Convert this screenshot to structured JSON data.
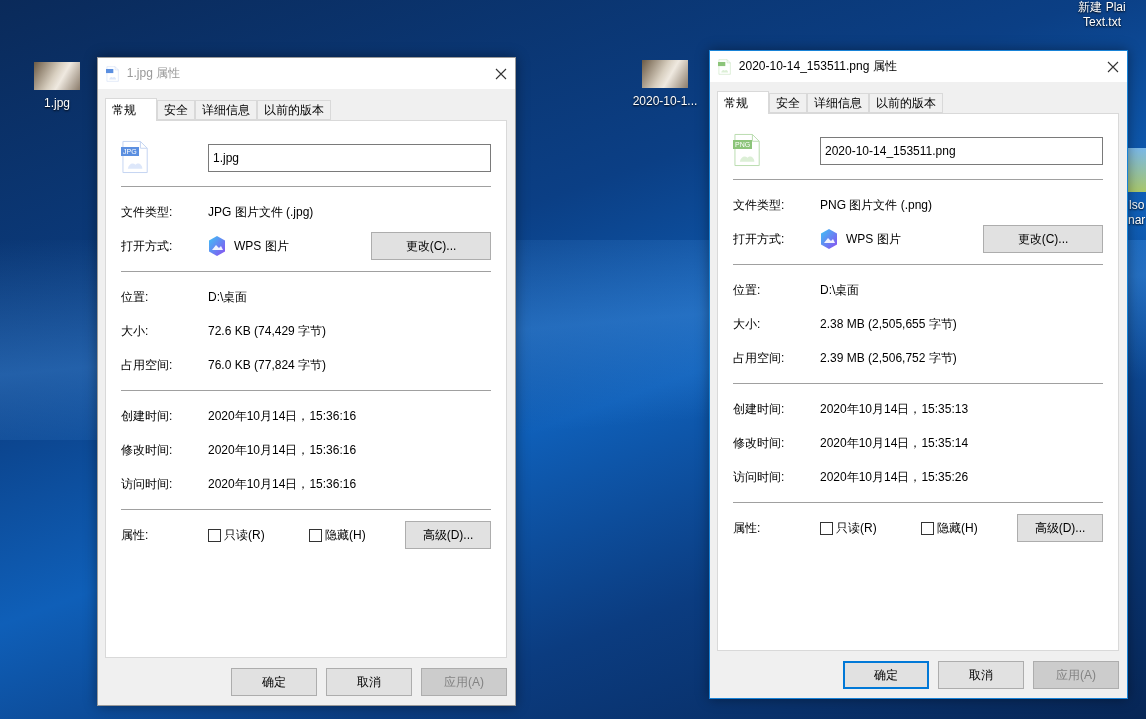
{
  "desktop_icons": [
    {
      "label": "1.jpg",
      "kind": "photo"
    },
    {
      "label": "2020-10-1...",
      "kind": "photo"
    },
    {
      "label": "新建 Plai\nText.txt",
      "kind": "text"
    },
    {
      "label": "lso\nnar",
      "kind": "app"
    }
  ],
  "windows": [
    {
      "title": "1.jpg 属性",
      "active": false,
      "badge": "JPG",
      "tabs": [
        {
          "label": "常规",
          "selected": true
        },
        {
          "label": "安全",
          "selected": false
        },
        {
          "label": "详细信息",
          "selected": false
        },
        {
          "label": "以前的版本",
          "selected": false
        }
      ],
      "name_value": "1.jpg",
      "sections": [
        [
          {
            "label": "文件类型:",
            "value": "JPG 图片文件 (.jpg)"
          },
          {
            "label": "打开方式:",
            "value": "WPS 图片",
            "kind": "app",
            "button": "更改(C)..."
          }
        ],
        [
          {
            "label": "位置:",
            "value": "D:\\桌面"
          },
          {
            "label": "大小:",
            "value": "72.6 KB (74,429 字节)"
          },
          {
            "label": "占用空间:",
            "value": "76.0 KB (77,824 字节)"
          }
        ],
        [
          {
            "label": "创建时间:",
            "value": "2020年10月14日，15:36:16"
          },
          {
            "label": "修改时间:",
            "value": "2020年10月14日，15:36:16"
          },
          {
            "label": "访问时间:",
            "value": "2020年10月14日，15:36:16"
          }
        ]
      ],
      "attributes": {
        "label": "属性:",
        "checkboxes": [
          {
            "label": "只读(R)",
            "checked": false
          },
          {
            "label": "隐藏(H)",
            "checked": false
          }
        ],
        "button": "高级(D)..."
      },
      "buttons": [
        {
          "label": "确定",
          "default": false,
          "disabled": false
        },
        {
          "label": "取消",
          "default": false,
          "disabled": false
        },
        {
          "label": "应用(A)",
          "default": false,
          "disabled": true
        }
      ]
    },
    {
      "title": "2020-10-14_153511.png 属性",
      "active": true,
      "badge": "PNG",
      "tabs": [
        {
          "label": "常规",
          "selected": true
        },
        {
          "label": "安全",
          "selected": false
        },
        {
          "label": "详细信息",
          "selected": false
        },
        {
          "label": "以前的版本",
          "selected": false
        }
      ],
      "name_value": "2020-10-14_153511.png",
      "sections": [
        [
          {
            "label": "文件类型:",
            "value": "PNG 图片文件 (.png)"
          },
          {
            "label": "打开方式:",
            "value": "WPS 图片",
            "kind": "app",
            "button": "更改(C)..."
          }
        ],
        [
          {
            "label": "位置:",
            "value": "D:\\桌面"
          },
          {
            "label": "大小:",
            "value": "2.38 MB (2,505,655 字节)"
          },
          {
            "label": "占用空间:",
            "value": "2.39 MB (2,506,752 字节)"
          }
        ],
        [
          {
            "label": "创建时间:",
            "value": "2020年10月14日，15:35:13"
          },
          {
            "label": "修改时间:",
            "value": "2020年10月14日，15:35:14"
          },
          {
            "label": "访问时间:",
            "value": "2020年10月14日，15:35:26"
          }
        ]
      ],
      "attributes": {
        "label": "属性:",
        "checkboxes": [
          {
            "label": "只读(R)",
            "checked": false
          },
          {
            "label": "隐藏(H)",
            "checked": false
          }
        ],
        "button": "高级(D)..."
      },
      "buttons": [
        {
          "label": "确定",
          "default": true,
          "disabled": false
        },
        {
          "label": "取消",
          "default": false,
          "disabled": false
        },
        {
          "label": "应用(A)",
          "default": false,
          "disabled": true
        }
      ]
    }
  ]
}
